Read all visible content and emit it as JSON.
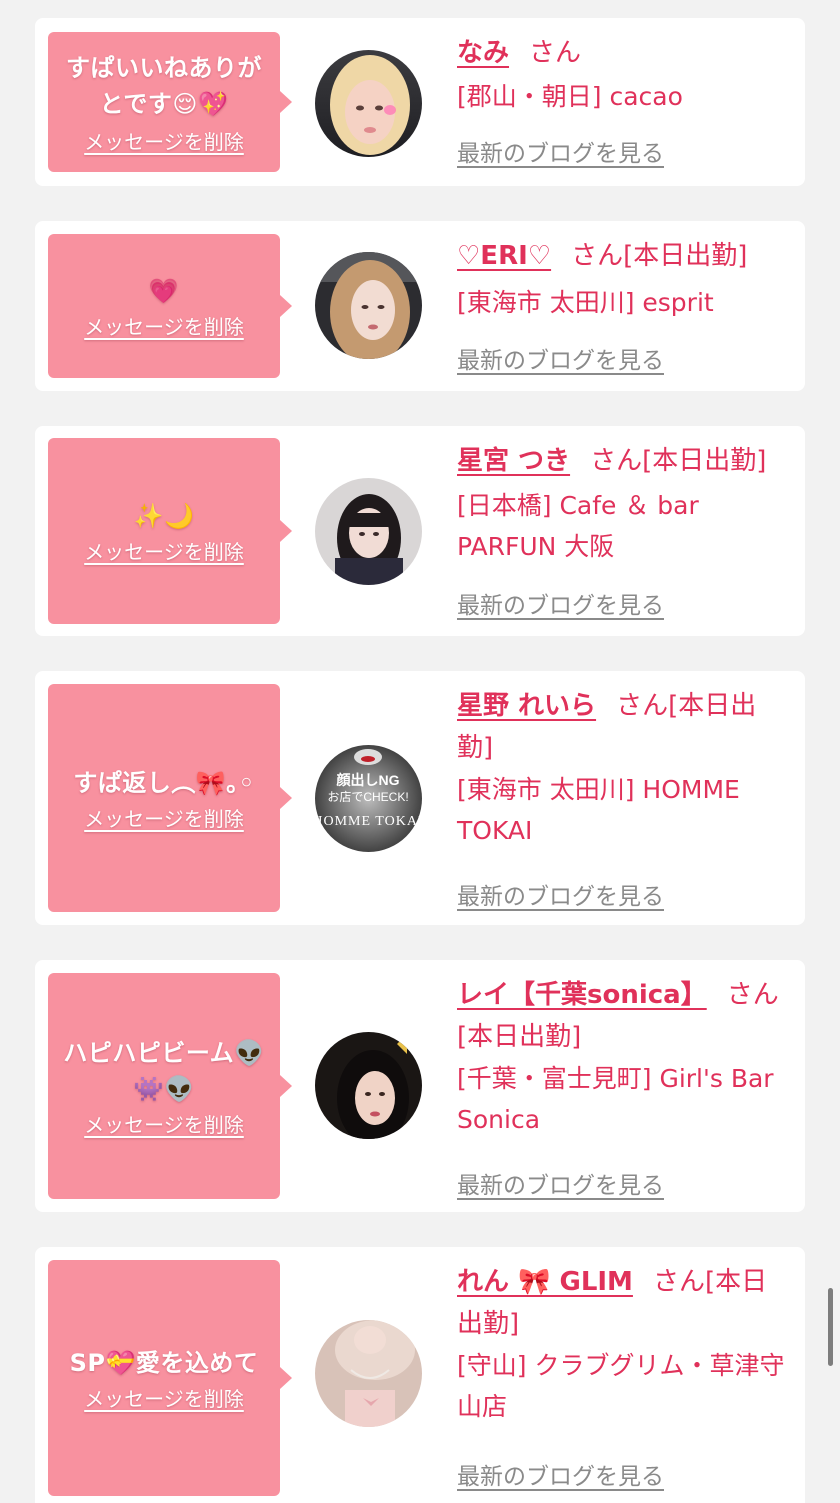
{
  "delete_label": "メッセージを削除",
  "blog_label": "最新のブログを見る",
  "cards": [
    {
      "message": "すぱいいねありがとです😌💖",
      "name": "なみ",
      "suffix": "さん",
      "shop": "[郡山・朝日] cacao"
    },
    {
      "message": "💗",
      "name": "♡ERI♡",
      "suffix": "さん[本日出勤]",
      "shop": "[東海市 太田川] esprit"
    },
    {
      "message": "✨🌙",
      "name": "星宮 つき",
      "suffix": "さん[本日出勤]",
      "shop": "[日本橋] Cafe ＆ bar PARFUN 大阪"
    },
    {
      "message": "すぱ返し︵🎀｡◦",
      "name": "星野 れいら",
      "suffix": "さん[本日出勤]",
      "shop": "[東海市 太田川] HOMME TOKAI",
      "avatar_text_1": "顔出しNG",
      "avatar_text_2": "お店でCHECK!",
      "avatar_text_3": "HOMME TOKAI"
    },
    {
      "message": "ハピハピビーム👽👾👽",
      "name": "レイ【千葉sonica】",
      "suffix": "さん[本日出勤]",
      "shop": "[千葉・富士見町] Girl's Bar Sonica"
    },
    {
      "message": "SP💝愛を込めて",
      "name": "れん 🎀 GLIM",
      "suffix": "さん[本日出勤]",
      "shop": "[守山] クラブグリム・草津守山店"
    }
  ],
  "colors": {
    "accent": "#e0315a",
    "bubble": "#f8919f",
    "background": "#f2f2f2",
    "link_gray": "#8a8a8a"
  }
}
